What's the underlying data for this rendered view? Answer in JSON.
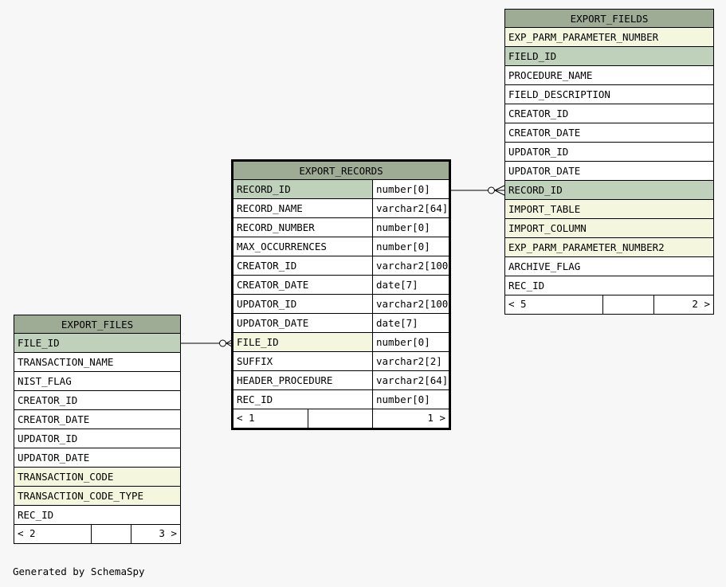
{
  "tables": {
    "export_records": {
      "name": "EXPORT_RECORDS",
      "columns": [
        {
          "name": "RECORD_ID",
          "type": "number[0]",
          "key": "pk"
        },
        {
          "name": "RECORD_NAME",
          "type": "varchar2[64]",
          "key": ""
        },
        {
          "name": "RECORD_NUMBER",
          "type": "number[0]",
          "key": ""
        },
        {
          "name": "MAX_OCCURRENCES",
          "type": "number[0]",
          "key": ""
        },
        {
          "name": "CREATOR_ID",
          "type": "varchar2[100]",
          "key": ""
        },
        {
          "name": "CREATOR_DATE",
          "type": "date[7]",
          "key": ""
        },
        {
          "name": "UPDATOR_ID",
          "type": "varchar2[100]",
          "key": ""
        },
        {
          "name": "UPDATOR_DATE",
          "type": "date[7]",
          "key": ""
        },
        {
          "name": "FILE_ID",
          "type": "number[0]",
          "key": "fk"
        },
        {
          "name": "SUFFIX",
          "type": "varchar2[2]",
          "key": ""
        },
        {
          "name": "HEADER_PROCEDURE",
          "type": "varchar2[64]",
          "key": ""
        },
        {
          "name": "REC_ID",
          "type": "number[0]",
          "key": ""
        }
      ],
      "footer": {
        "parents": "< 1",
        "middle": "",
        "children": "1 >"
      }
    },
    "export_fields": {
      "name": "EXPORT_FIELDS",
      "columns": [
        {
          "name": "EXP_PARM_PARAMETER_NUMBER",
          "key": "fk"
        },
        {
          "name": "FIELD_ID",
          "key": "pk"
        },
        {
          "name": "PROCEDURE_NAME",
          "key": ""
        },
        {
          "name": "FIELD_DESCRIPTION",
          "key": ""
        },
        {
          "name": "CREATOR_ID",
          "key": ""
        },
        {
          "name": "CREATOR_DATE",
          "key": ""
        },
        {
          "name": "UPDATOR_ID",
          "key": ""
        },
        {
          "name": "UPDATOR_DATE",
          "key": ""
        },
        {
          "name": "RECORD_ID",
          "key": "pk"
        },
        {
          "name": "IMPORT_TABLE",
          "key": "fk"
        },
        {
          "name": "IMPORT_COLUMN",
          "key": "fk"
        },
        {
          "name": "EXP_PARM_PARAMETER_NUMBER2",
          "key": "fk"
        },
        {
          "name": "ARCHIVE_FLAG",
          "key": ""
        },
        {
          "name": "REC_ID",
          "key": ""
        }
      ],
      "footer": {
        "parents": "< 5",
        "middle": "",
        "children": "2 >"
      }
    },
    "export_files": {
      "name": "EXPORT_FILES",
      "columns": [
        {
          "name": "FILE_ID",
          "key": "pk"
        },
        {
          "name": "TRANSACTION_NAME",
          "key": ""
        },
        {
          "name": "NIST_FLAG",
          "key": ""
        },
        {
          "name": "CREATOR_ID",
          "key": ""
        },
        {
          "name": "CREATOR_DATE",
          "key": ""
        },
        {
          "name": "UPDATOR_ID",
          "key": ""
        },
        {
          "name": "UPDATOR_DATE",
          "key": ""
        },
        {
          "name": "TRANSACTION_CODE",
          "key": "fk"
        },
        {
          "name": "TRANSACTION_CODE_TYPE",
          "key": "fk"
        },
        {
          "name": "REC_ID",
          "key": ""
        }
      ],
      "footer": {
        "parents": "< 2",
        "middle": "",
        "children": "3 >"
      }
    }
  },
  "relationships": [
    {
      "from": "EXPORT_RECORDS.RECORD_ID",
      "to": "EXPORT_FIELDS.RECORD_ID"
    },
    {
      "from": "EXPORT_FILES.FILE_ID",
      "to": "EXPORT_RECORDS.FILE_ID"
    }
  ],
  "colors": {
    "header": "#9eac96",
    "primary_key": "#bfd1ba",
    "foreign_key": "#f4f7dd",
    "background": "#f7f7f7"
  },
  "footer_note": "Generated by SchemaSpy"
}
